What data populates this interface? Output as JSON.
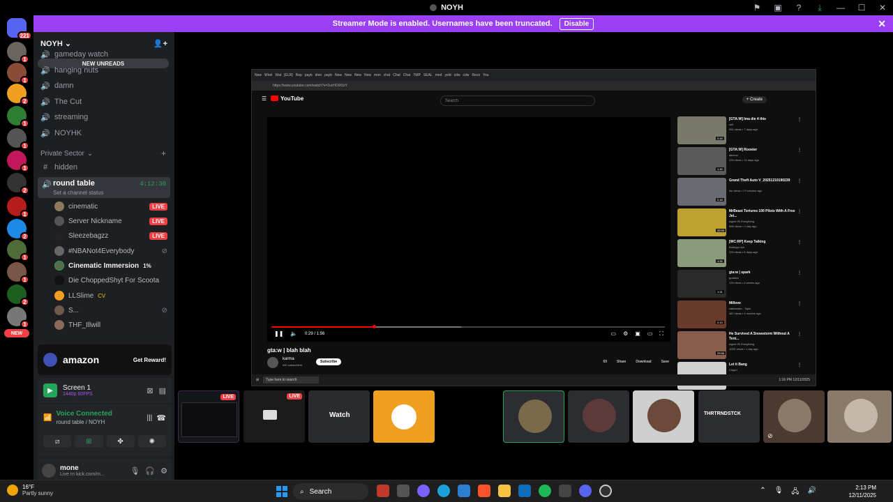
{
  "window": {
    "title": "NOYH"
  },
  "banner": {
    "text": "Streamer Mode is enabled. Usernames have been truncated.",
    "disable_label": "Disable"
  },
  "guilds": {
    "home_count": "221",
    "new_label": "NEW"
  },
  "server": {
    "name": "NOYH",
    "new_unreads": "NEW UNREADS",
    "channels": [
      "gameday watch",
      "hanging nuts",
      "damn",
      "The Cut",
      "streaming",
      "NOYHK"
    ],
    "category": "Private Sector",
    "hidden_channel": "hidden",
    "round_table": {
      "name": "round table",
      "status": "Set a channel status",
      "time": "4:12:30"
    },
    "members": [
      {
        "name": "cinematic",
        "live": "LIVE"
      },
      {
        "name": "Server Nickname",
        "live": "LIVE"
      },
      {
        "name": "Sleezebagzz",
        "live": "LIVE"
      },
      {
        "name": "#NBANot4Everybody"
      },
      {
        "name": "Cinematic Immersion",
        "extra": "1%"
      },
      {
        "name": "Die ChoppedShyt For Scoota"
      },
      {
        "name": "LLSlime",
        "extra": "CV"
      },
      {
        "name": "S..."
      },
      {
        "name": "THF_Illwill"
      }
    ]
  },
  "promo": {
    "brand": "amazon",
    "cta": "Get Reward!"
  },
  "screen_share": {
    "title": "Screen 1",
    "quality": "1440p 60FPS"
  },
  "voice": {
    "status": "Voice Connected",
    "location": "round table / NOYH"
  },
  "user": {
    "name": "mone",
    "status": "Live rn kick.com/m..."
  },
  "stream": {
    "tabs": [
      "New",
      "Wirel",
      "Wat",
      "[ELR]",
      "Rep",
      "payb",
      "dion",
      "payb",
      "New",
      "New",
      "New",
      "New",
      "mon",
      "chat",
      "Chat",
      "Chat",
      "TMP",
      "SEAL",
      "med",
      "yeld",
      "cdw",
      "cdw",
      "Reco",
      "You"
    ],
    "url": "https://www.youtube.com/watch?v=2ucHOlX0zY",
    "youtube": "YouTube",
    "search": "Search",
    "create": "+ Create",
    "time": "0:29 / 1:56",
    "video_title": "gta:w | blah blah",
    "channel": "karma",
    "subs": "590 subscribers",
    "subscribe": "Subscribe",
    "actions": [
      "69",
      "Share",
      "Download",
      "Save"
    ],
    "recs": [
      {
        "title": "[GTA:W] Ima die 4 this",
        "meta": [
          "self",
          "551 views • 7 days ago"
        ],
        "dur": "2:44"
      },
      {
        "title": "[GTA:W] Rooster",
        "meta": [
          "takeruo",
          "225 views • 11 days ago"
        ],
        "dur": "1:40"
      },
      {
        "title": "Grand Theft Auto V_20251210190239",
        "meta": [
          "No views • 17 minutes ago"
        ],
        "dur": "2:18"
      },
      {
        "title": "MrBeast Tortures 100 Pilots With A Free Jet...",
        "meta": [
          "Agent 00 Everything",
          "59K views • 1 day ago"
        ],
        "dur": "39:55"
      },
      {
        "title": "[WC:RP] Keep Talking",
        "meta": [
          "Bottega Live",
          "333 views • 6 days ago"
        ],
        "dur": "1:32"
      },
      {
        "title": "gta:w | spark",
        "meta": [
          "godskin",
          "125 views • 4 weeks ago"
        ],
        "dur": "1:31"
      },
      {
        "title": "Millove",
        "meta": [
          "saltdombo - Topic",
          "387 views • 4 months ago"
        ],
        "dur": "2:13"
      },
      {
        "title": "He Survived A Snowstorm Without A Tent...",
        "meta": [
          "Agent 00 Everything",
          "102K views • 1 day ago"
        ],
        "dur": "29:56"
      },
      {
        "title": "Let it Bang",
        "meta": [
          "Ckppd"
        ],
        "dur": ""
      }
    ],
    "mini_taskbar": {
      "search": "Type here to search",
      "time": "1:16 PM",
      "date": "12/11/2025"
    }
  },
  "tiles": [
    {
      "live": "LIVE"
    },
    {
      "live": "LIVE"
    },
    {
      "label": "Watch"
    },
    {},
    {},
    {},
    {},
    {},
    {
      "label": "THRTRNDSTCK"
    },
    {},
    {}
  ],
  "taskbar": {
    "temp": "16°F",
    "condition": "Partly sunny",
    "search": "Search",
    "time": "2:13 PM",
    "date": "12/11/2025"
  },
  "colors": {
    "discord_bg": "#1e1f22",
    "accent": "#9b3ff5",
    "live": "#f23f43",
    "online": "#23a55a"
  }
}
